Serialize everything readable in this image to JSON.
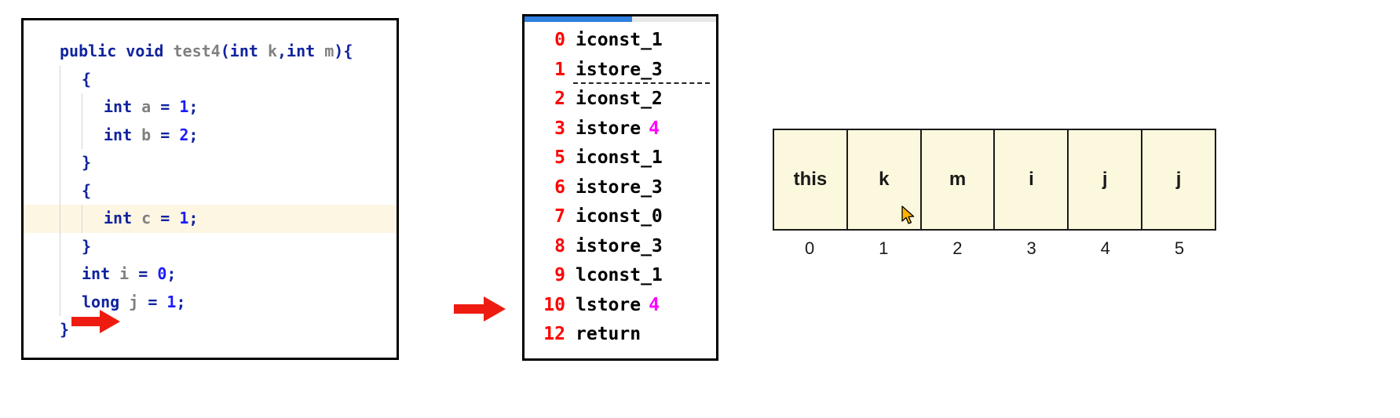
{
  "code_panel": {
    "name": "java-source-editor",
    "highlighted_line_index": 6,
    "marked_line_index": 9,
    "lines": [
      {
        "indent": 0,
        "tokens": [
          {
            "t": "public",
            "c": "kw"
          },
          {
            "t": " ",
            "c": "plain"
          },
          {
            "t": "void",
            "c": "kw"
          },
          {
            "t": " ",
            "c": "plain"
          },
          {
            "t": "test4",
            "c": "id"
          },
          {
            "t": "(",
            "c": "punc"
          },
          {
            "t": "int",
            "c": "kw"
          },
          {
            "t": " ",
            "c": "plain"
          },
          {
            "t": "k",
            "c": "id"
          },
          {
            "t": ",",
            "c": "punc"
          },
          {
            "t": "int",
            "c": "kw"
          },
          {
            "t": " ",
            "c": "plain"
          },
          {
            "t": "m",
            "c": "id"
          },
          {
            "t": ")",
            "c": "punc"
          },
          {
            "t": "{",
            "c": "punc"
          }
        ]
      },
      {
        "indent": 1,
        "tokens": [
          {
            "t": "{",
            "c": "punc"
          }
        ]
      },
      {
        "indent": 2,
        "tokens": [
          {
            "t": "int",
            "c": "kw"
          },
          {
            "t": " ",
            "c": "plain"
          },
          {
            "t": "a",
            "c": "id"
          },
          {
            "t": " ",
            "c": "plain"
          },
          {
            "t": "=",
            "c": "punc"
          },
          {
            "t": " ",
            "c": "plain"
          },
          {
            "t": "1",
            "c": "num"
          },
          {
            "t": ";",
            "c": "punc"
          }
        ]
      },
      {
        "indent": 2,
        "tokens": [
          {
            "t": "int",
            "c": "kw"
          },
          {
            "t": " ",
            "c": "plain"
          },
          {
            "t": "b",
            "c": "id"
          },
          {
            "t": " ",
            "c": "plain"
          },
          {
            "t": "=",
            "c": "punc"
          },
          {
            "t": " ",
            "c": "plain"
          },
          {
            "t": "2",
            "c": "num"
          },
          {
            "t": ";",
            "c": "punc"
          }
        ]
      },
      {
        "indent": 1,
        "tokens": [
          {
            "t": "}",
            "c": "punc"
          }
        ]
      },
      {
        "indent": 1,
        "tokens": [
          {
            "t": "{",
            "c": "punc"
          }
        ]
      },
      {
        "indent": 2,
        "tokens": [
          {
            "t": "int",
            "c": "kw"
          },
          {
            "t": " ",
            "c": "plain"
          },
          {
            "t": "c",
            "c": "id"
          },
          {
            "t": " ",
            "c": "plain"
          },
          {
            "t": "=",
            "c": "punc"
          },
          {
            "t": " ",
            "c": "plain"
          },
          {
            "t": "1",
            "c": "num"
          },
          {
            "t": ";",
            "c": "punc"
          }
        ]
      },
      {
        "indent": 1,
        "tokens": [
          {
            "t": "}",
            "c": "punc"
          }
        ]
      },
      {
        "indent": 1,
        "tokens": [
          {
            "t": "int",
            "c": "kw"
          },
          {
            "t": " ",
            "c": "plain"
          },
          {
            "t": "i",
            "c": "id"
          },
          {
            "t": " ",
            "c": "plain"
          },
          {
            "t": "=",
            "c": "punc"
          },
          {
            "t": " ",
            "c": "plain"
          },
          {
            "t": "0",
            "c": "num"
          },
          {
            "t": ";",
            "c": "punc"
          }
        ]
      },
      {
        "indent": 1,
        "tokens": [
          {
            "t": "long",
            "c": "kw"
          },
          {
            "t": " ",
            "c": "plain"
          },
          {
            "t": "j",
            "c": "id"
          },
          {
            "t": " ",
            "c": "plain"
          },
          {
            "t": "=",
            "c": "punc"
          },
          {
            "t": " ",
            "c": "plain"
          },
          {
            "t": "1",
            "c": "num"
          },
          {
            "t": ";",
            "c": "punc"
          }
        ]
      },
      {
        "indent": 0,
        "tokens": [
          {
            "t": "}",
            "c": "punc"
          }
        ]
      }
    ]
  },
  "bytecode_panel": {
    "name": "jvm-bytecode-view",
    "scrollbar": {
      "thumb_percent": 56
    },
    "dashed_after_index": 1,
    "instructions": [
      {
        "offset": "0",
        "op": "iconst_1",
        "arg": ""
      },
      {
        "offset": "1",
        "op": "istore_3",
        "arg": ""
      },
      {
        "offset": "2",
        "op": "iconst_2",
        "arg": ""
      },
      {
        "offset": "3",
        "op": "istore",
        "arg": "4"
      },
      {
        "offset": "5",
        "op": "iconst_1",
        "arg": ""
      },
      {
        "offset": "6",
        "op": "istore_3",
        "arg": ""
      },
      {
        "offset": "7",
        "op": "iconst_0",
        "arg": ""
      },
      {
        "offset": "8",
        "op": "istore_3",
        "arg": ""
      },
      {
        "offset": "9",
        "op": "lconst_1",
        "arg": ""
      },
      {
        "offset": "10",
        "op": "lstore",
        "arg": "4"
      },
      {
        "offset": "12",
        "op": "return",
        "arg": ""
      }
    ]
  },
  "locals_table": {
    "name": "local-variable-slot-table",
    "slots": [
      "this",
      "k",
      "m",
      "i",
      "j",
      "j"
    ],
    "indices": [
      "0",
      "1",
      "2",
      "3",
      "4",
      "5"
    ]
  },
  "colors": {
    "arrow_red": "#ee1b11",
    "bytecode_offset": "#ff0000",
    "bytecode_arg": "#ff00ff",
    "keyword_blue": "#10239e",
    "literal_blue": "#1a1aff",
    "identifier_gray": "#808080",
    "slot_fill": "#fbf8dd",
    "highlight_line": "#fdf6e3",
    "scrollbar_thumb": "#2f80e0"
  }
}
